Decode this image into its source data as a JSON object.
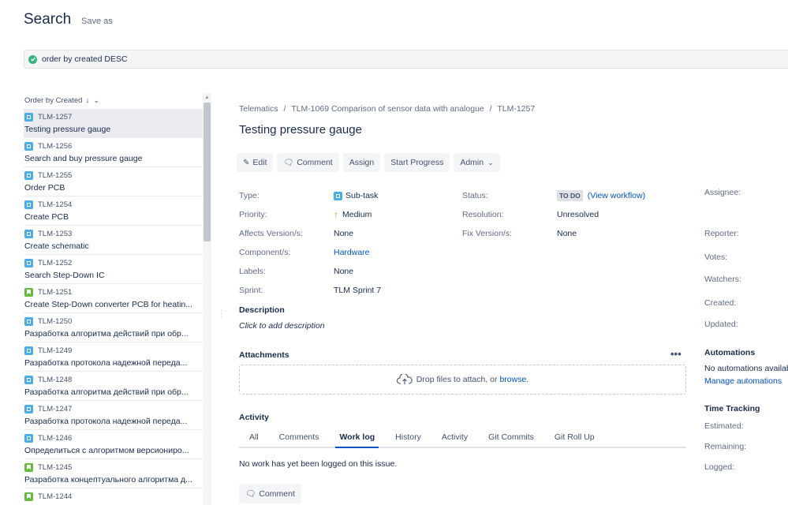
{
  "header": {
    "title": "Search",
    "save_as": "Save as"
  },
  "jql": {
    "query": "order by created DESC"
  },
  "list": {
    "order_label": "Order by Created",
    "items": [
      {
        "key": "TLM-1257",
        "summary": "Testing pressure gauge",
        "type": "subtask"
      },
      {
        "key": "TLM-1256",
        "summary": "Search and buy pressure gauge",
        "type": "subtask"
      },
      {
        "key": "TLM-1255",
        "summary": "Order PCB",
        "type": "subtask"
      },
      {
        "key": "TLM-1254",
        "summary": "Create PCB",
        "type": "subtask"
      },
      {
        "key": "TLM-1253",
        "summary": "Create schematic",
        "type": "subtask"
      },
      {
        "key": "TLM-1252",
        "summary": "Search Step-Down IC",
        "type": "subtask"
      },
      {
        "key": "TLM-1251",
        "summary": "Create Step-Down converter PCB for heatin...",
        "type": "story"
      },
      {
        "key": "TLM-1250",
        "summary": "Разработка алгоритма действий при обр...",
        "type": "subtask"
      },
      {
        "key": "TLM-1249",
        "summary": "Разработка протокола надежной переда...",
        "type": "subtask"
      },
      {
        "key": "TLM-1248",
        "summary": "Разработка алгоритма действий при обр...",
        "type": "subtask"
      },
      {
        "key": "TLM-1247",
        "summary": "Разработка протокола надежной переда...",
        "type": "subtask"
      },
      {
        "key": "TLM-1246",
        "summary": "Определиться с алгоритмом версиониро...",
        "type": "subtask"
      },
      {
        "key": "TLM-1245",
        "summary": "Разработка концептуального алгоритма д...",
        "type": "story"
      },
      {
        "key": "TLM-1244",
        "summary": "",
        "type": "story"
      }
    ]
  },
  "breadcrumb": {
    "project": "Telematics",
    "parent": "TLM-1069 Comparison of sensor data with analogue",
    "current": "TLM-1257"
  },
  "issue": {
    "title": "Testing pressure gauge",
    "toolbar": {
      "edit": "Edit",
      "comment": "Comment",
      "assign": "Assign",
      "start_progress": "Start Progress",
      "admin": "Admin"
    },
    "fields": {
      "type_label": "Type:",
      "type_value": "Sub-task",
      "priority_label": "Priority:",
      "priority_value": "Medium",
      "affects_label": "Affects Version/s:",
      "affects_value": "None",
      "component_label": "Component/s:",
      "component_value": "Hardware",
      "labels_label": "Labels:",
      "labels_value": "None",
      "sprint_label": "Sprint:",
      "sprint_value": "TLM Sprint 7",
      "status_label": "Status:",
      "status_value": "TO DO",
      "view_workflow": "(View workflow)",
      "resolution_label": "Resolution:",
      "resolution_value": "Unresolved",
      "fix_label": "Fix Version/s:",
      "fix_value": "None"
    },
    "description_heading": "Description",
    "description_placeholder": "Click to add description",
    "attachments_heading": "Attachments",
    "dropzone_text": "Drop files to attach, or",
    "dropzone_link": "browse.",
    "activity_heading": "Activity",
    "tabs": [
      "All",
      "Comments",
      "Work log",
      "History",
      "Activity",
      "Git Commits",
      "Git Roll Up"
    ],
    "active_tab": "Work log",
    "no_work": "No work has yet been logged on this issue.",
    "comment_button": "Comment"
  },
  "side": {
    "assignee": "Assignee:",
    "reporter": "Reporter:",
    "votes": "Votes:",
    "watchers": "Watchers:",
    "created": "Created:",
    "updated": "Updated:",
    "automations_heading": "Automations",
    "automations_text": "No automations available",
    "manage_automations": "Manage automations",
    "time_tracking_heading": "Time Tracking",
    "estimated": "Estimated:",
    "remaining": "Remaining:",
    "logged": "Logged:"
  }
}
